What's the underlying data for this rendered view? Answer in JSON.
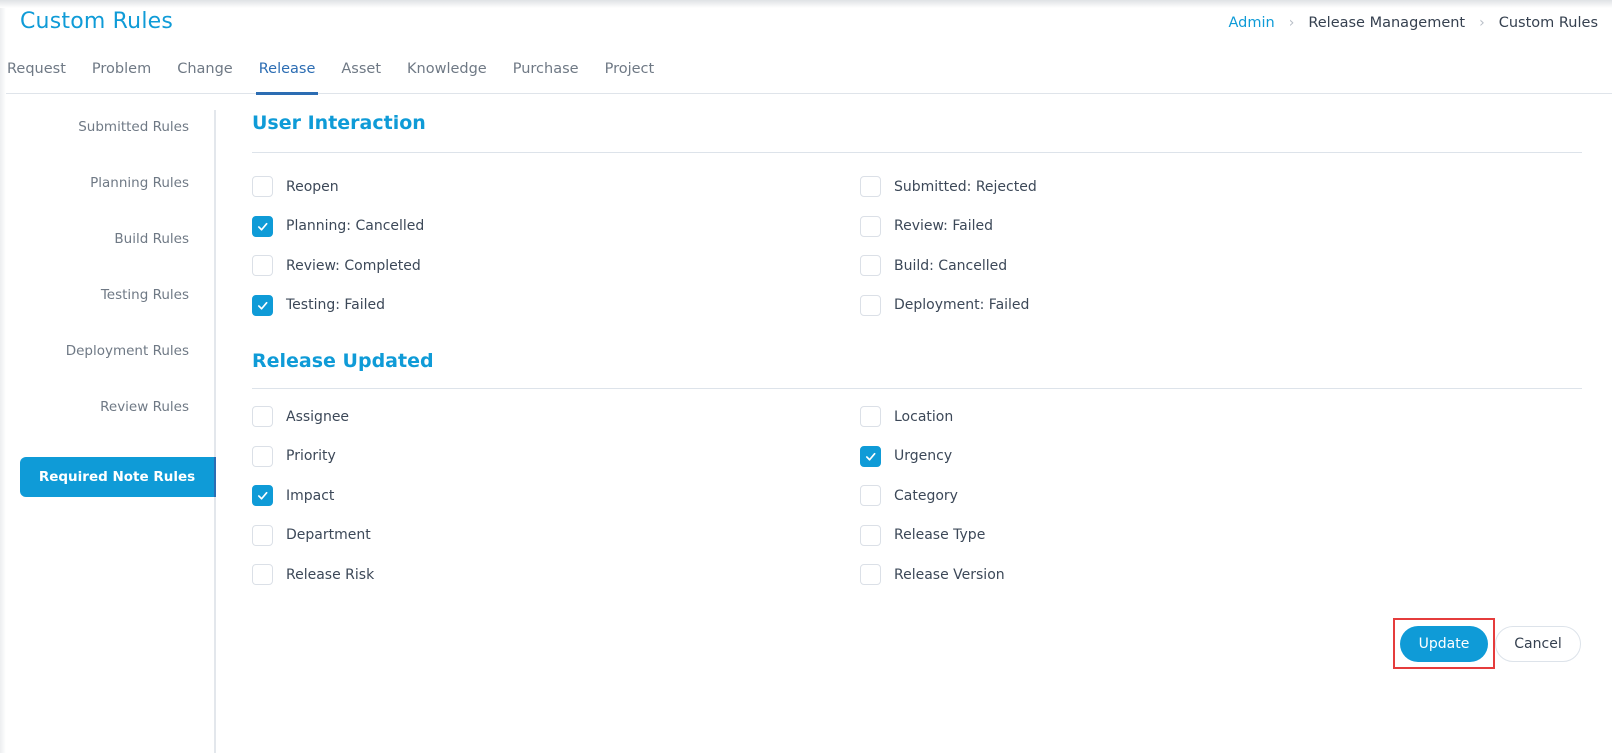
{
  "header": {
    "title": "Custom Rules",
    "breadcrumb": [
      "Admin",
      "Release Management",
      "Custom Rules"
    ]
  },
  "tabs": [
    {
      "label": "Request",
      "active": false
    },
    {
      "label": "Problem",
      "active": false
    },
    {
      "label": "Change",
      "active": false
    },
    {
      "label": "Release",
      "active": true
    },
    {
      "label": "Asset",
      "active": false
    },
    {
      "label": "Knowledge",
      "active": false
    },
    {
      "label": "Purchase",
      "active": false
    },
    {
      "label": "Project",
      "active": false
    }
  ],
  "sidebar": {
    "items": [
      {
        "label": "Submitted Rules",
        "active": false
      },
      {
        "label": "Planning Rules",
        "active": false
      },
      {
        "label": "Build Rules",
        "active": false
      },
      {
        "label": "Testing Rules",
        "active": false
      },
      {
        "label": "Deployment Rules",
        "active": false
      },
      {
        "label": "Review Rules",
        "active": false
      },
      {
        "label": "Required Note Rules",
        "active": true
      }
    ]
  },
  "sections": [
    {
      "title": "User Interaction",
      "left": [
        {
          "label": "Reopen",
          "checked": false
        },
        {
          "label": "Planning: Cancelled",
          "checked": true
        },
        {
          "label": "Review: Completed",
          "checked": false
        },
        {
          "label": "Testing: Failed",
          "checked": true
        }
      ],
      "right": [
        {
          "label": "Submitted: Rejected",
          "checked": false
        },
        {
          "label": "Review: Failed",
          "checked": false
        },
        {
          "label": "Build: Cancelled",
          "checked": false
        },
        {
          "label": "Deployment: Failed",
          "checked": false
        }
      ]
    },
    {
      "title": "Release Updated",
      "left": [
        {
          "label": "Assignee",
          "checked": false
        },
        {
          "label": "Priority",
          "checked": false
        },
        {
          "label": "Impact",
          "checked": true
        },
        {
          "label": "Department",
          "checked": false
        },
        {
          "label": "Release Risk",
          "checked": false
        }
      ],
      "right": [
        {
          "label": "Location",
          "checked": false
        },
        {
          "label": "Urgency",
          "checked": true
        },
        {
          "label": "Category",
          "checked": false
        },
        {
          "label": "Release Type",
          "checked": false
        },
        {
          "label": "Release Version",
          "checked": false
        }
      ]
    }
  ],
  "actions": {
    "update_label": "Update",
    "cancel_label": "Cancel"
  },
  "colors": {
    "accent": "#0f9bd7",
    "active_tab": "#2c6db3",
    "highlight": "#e53c3c"
  }
}
